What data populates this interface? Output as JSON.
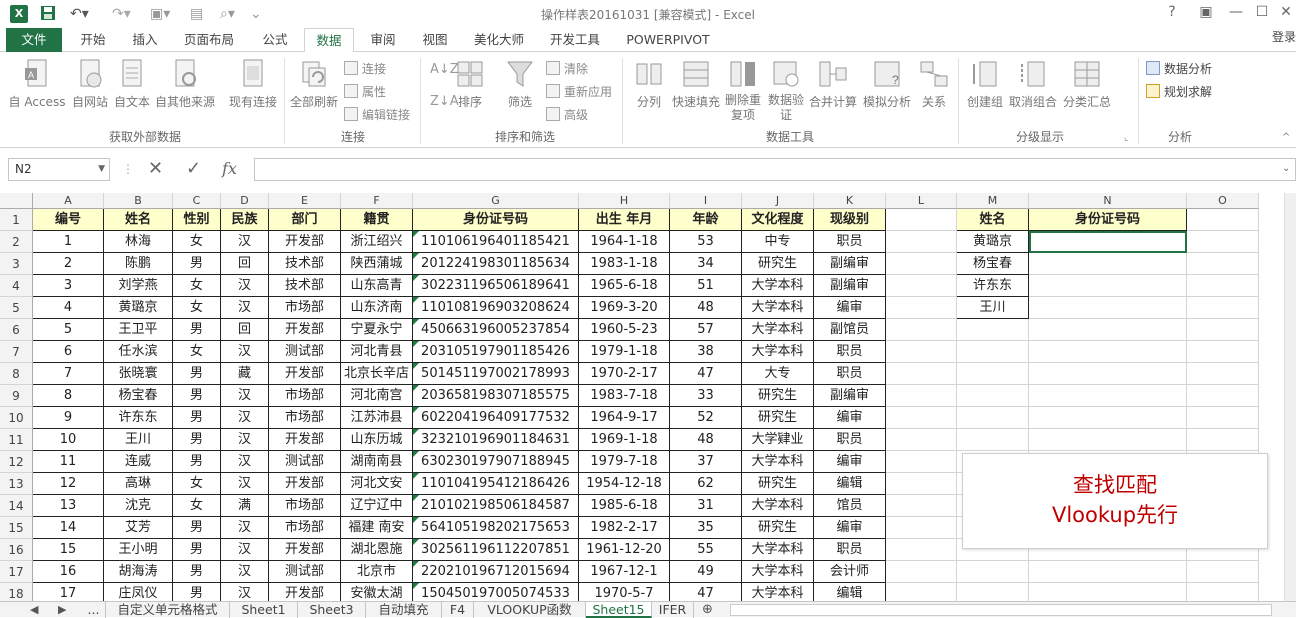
{
  "window": {
    "title": "操作样表20161031 [兼容模式] - Excel",
    "login": "登录"
  },
  "ribbon_tabs": [
    "文件",
    "开始",
    "插入",
    "页面布局",
    "公式",
    "数据",
    "审阅",
    "视图",
    "美化大师",
    "开发工具",
    "POWERPIVOT"
  ],
  "active_tab": "数据",
  "ribbon": {
    "get_external": [
      "自 Access",
      "自网站",
      "自文本",
      "自其他来源",
      "现有连接"
    ],
    "get_external_group": "获取外部数据",
    "refresh_all": "全部刷新",
    "connections_small": [
      "连接",
      "属性",
      "编辑链接"
    ],
    "connections_group": "连接",
    "sort": "排序",
    "filter": "筛选",
    "filter_small": [
      "清除",
      "重新应用",
      "高级"
    ],
    "sort_filter_group": "排序和筛选",
    "data_tools": [
      "分列",
      "快速填充",
      "删除重复项",
      "数据验证",
      "合并计算",
      "模拟分析",
      "关系"
    ],
    "data_tools_group": "数据工具",
    "outline": [
      "创建组",
      "取消组合",
      "分类汇总"
    ],
    "outline_group": "分级显示",
    "analysis_small": [
      "数据分析",
      "规划求解"
    ],
    "analysis_group": "分析"
  },
  "formula_bar": {
    "name_box": "N2",
    "fx": "fx",
    "value": ""
  },
  "columns": [
    "A",
    "B",
    "C",
    "D",
    "E",
    "F",
    "G",
    "H",
    "I",
    "J",
    "K",
    "L",
    "M",
    "N",
    "O"
  ],
  "rows": [
    "1",
    "2",
    "3",
    "4",
    "5",
    "6",
    "7",
    "8",
    "9",
    "10",
    "11",
    "12",
    "13",
    "14",
    "15",
    "16",
    "17",
    "18"
  ],
  "table_headers": [
    "编号",
    "姓名",
    "性别",
    "民族",
    "部门",
    "籍贯",
    "身份证号码",
    "出生 年月",
    "年龄",
    "文化程度",
    "现级别"
  ],
  "table_rows": [
    [
      "1",
      "林海",
      "女",
      "汉",
      "开发部",
      "浙江绍兴",
      "110106196401185421",
      "1964-1-18",
      "53",
      "中专",
      "职员"
    ],
    [
      "2",
      "陈鹏",
      "男",
      "回",
      "技术部",
      "陕西蒲城",
      "201224198301185634",
      "1983-1-18",
      "34",
      "研究生",
      "副编审"
    ],
    [
      "3",
      "刘学燕",
      "女",
      "汉",
      "技术部",
      "山东高青",
      "302231196506189641",
      "1965-6-18",
      "51",
      "大学本科",
      "副编审"
    ],
    [
      "4",
      "黄璐京",
      "女",
      "汉",
      "市场部",
      "山东济南",
      "110108196903208624",
      "1969-3-20",
      "48",
      "大学本科",
      "编审"
    ],
    [
      "5",
      "王卫平",
      "男",
      "回",
      "开发部",
      "宁夏永宁",
      "450663196005237854",
      "1960-5-23",
      "57",
      "大学本科",
      "副馆员"
    ],
    [
      "6",
      "任水滨",
      "女",
      "汉",
      "测试部",
      "河北青县",
      "203105197901185426",
      "1979-1-18",
      "38",
      "大学本科",
      "职员"
    ],
    [
      "7",
      "张晓寰",
      "男",
      "藏",
      "开发部",
      "北京长辛店",
      "501451197002178993",
      "1970-2-17",
      "47",
      "大专",
      "职员"
    ],
    [
      "8",
      "杨宝春",
      "男",
      "汉",
      "市场部",
      "河北南宫",
      "203658198307185575",
      "1983-7-18",
      "33",
      "研究生",
      "副编审"
    ],
    [
      "9",
      "许东东",
      "男",
      "汉",
      "市场部",
      "江苏沛县",
      "602204196409177532",
      "1964-9-17",
      "52",
      "研究生",
      "编审"
    ],
    [
      "10",
      "王川",
      "男",
      "汉",
      "开发部",
      "山东历城",
      "323210196901184631",
      "1969-1-18",
      "48",
      "大学肄业",
      "职员"
    ],
    [
      "11",
      "连威",
      "男",
      "汉",
      "测试部",
      "湖南南县",
      "630230197907188945",
      "1979-7-18",
      "37",
      "大学本科",
      "编审"
    ],
    [
      "12",
      "高琳",
      "女",
      "汉",
      "开发部",
      "河北文安",
      "110104195412186426",
      "1954-12-18",
      "62",
      "研究生",
      "编辑"
    ],
    [
      "13",
      "沈克",
      "女",
      "满",
      "市场部",
      "辽宁辽中",
      "210102198506184587",
      "1985-6-18",
      "31",
      "大学本科",
      "馆员"
    ],
    [
      "14",
      "艾芳",
      "男",
      "汉",
      "市场部",
      "福建 南安",
      "564105198202175653",
      "1982-2-17",
      "35",
      "研究生",
      "编审"
    ],
    [
      "15",
      "王小明",
      "男",
      "汉",
      "开发部",
      "湖北恩施",
      "302561196112207851",
      "1961-12-20",
      "55",
      "大学本科",
      "职员"
    ],
    [
      "16",
      "胡海涛",
      "男",
      "汉",
      "测试部",
      "北京市",
      "220210196712015694",
      "1967-12-1",
      "49",
      "大学本科",
      "会计师"
    ],
    [
      "17",
      "庄凤仪",
      "男",
      "汉",
      "开发部",
      "安徽太湖",
      "150450197005074533",
      "1970-5-7",
      "47",
      "大学本科",
      "编辑"
    ]
  ],
  "lookup": {
    "headers": [
      "姓名",
      "身份证号码"
    ],
    "names": [
      "黄璐京",
      "杨宝春",
      "许东东",
      "王川"
    ]
  },
  "callout": {
    "line1": "查找匹配",
    "line2": "Vlookup先行"
  },
  "sheet_tabs": [
    "...",
    "自定义单元格格式",
    "Sheet1",
    "Sheet3",
    "自动填充",
    "F4",
    "VLOOKUP函数",
    "Sheet15",
    "IFER"
  ],
  "active_sheet": "Sheet15",
  "colors": {
    "excel_green": "#217346",
    "header_fill": "#ffffcc",
    "callout_text": "#c00000"
  }
}
